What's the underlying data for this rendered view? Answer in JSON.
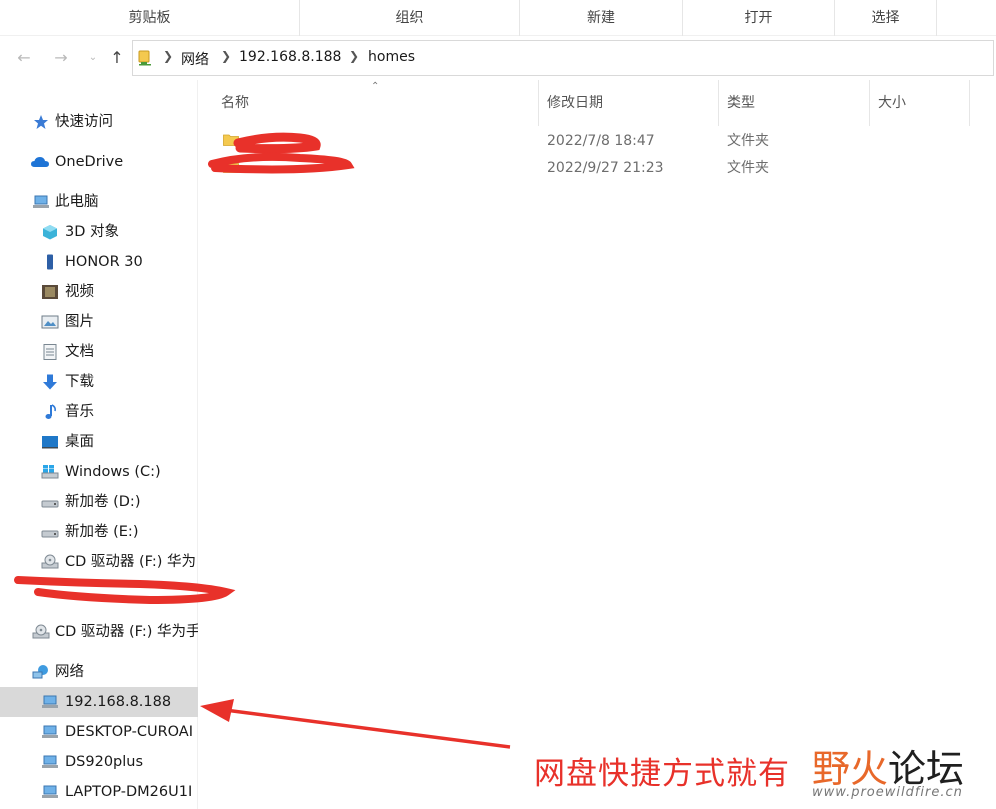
{
  "ribbon": {
    "groups": [
      "剪贴板",
      "组织",
      "新建",
      "打开",
      "选择"
    ]
  },
  "address": {
    "back_icon": "back-arrow-icon",
    "forward_icon": "forward-arrow-icon",
    "up_icon": "up-arrow-icon",
    "crumbs": [
      "网络",
      "192.168.8.188",
      "homes"
    ]
  },
  "sidebar": {
    "quick_access": "快速访问",
    "onedrive": "OneDrive",
    "this_pc": "此电脑",
    "objects3d": "3D 对象",
    "honor": "HONOR 30",
    "videos": "视频",
    "pictures": "图片",
    "documents": "文档",
    "downloads": "下载",
    "music": "音乐",
    "desktop": "桌面",
    "drive_c": "Windows (C:)",
    "drive_d": "新加卷 (D:)",
    "drive_e": "新加卷 (E:)",
    "drive_f": "CD 驱动器 (F:) 华为",
    "drive_f2": "CD 驱动器 (F:) 华为手",
    "network": "网络",
    "net_188": "192.168.8.188",
    "net_desktop": "DESKTOP-CUROAI",
    "net_ds920": "DS920plus",
    "net_laptop": "LAPTOP-DM26U1I"
  },
  "columns": {
    "name": "名称",
    "modified": "修改日期",
    "type": "类型",
    "size": "大小"
  },
  "files": [
    {
      "date": "2022/7/8 18:47",
      "type": "文件夹"
    },
    {
      "date": "2022/9/27 21:23",
      "type": "文件夹"
    }
  ],
  "annotation": {
    "text": "网盘快捷方式就有"
  },
  "watermark": {
    "ye": "野火",
    "rest": "论坛",
    "url": "www.proewildfire.cn"
  },
  "colors": {
    "annotation_red": "#e8312a",
    "selected_row": "#d9d9d9",
    "folder_yellow": "#f4c94f"
  }
}
